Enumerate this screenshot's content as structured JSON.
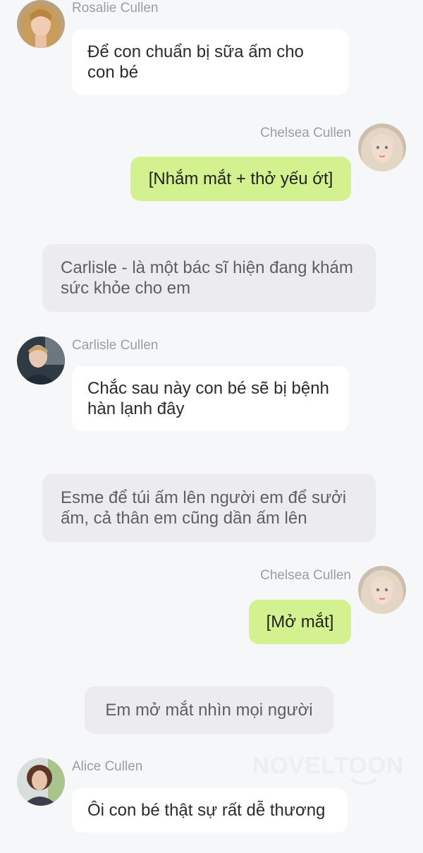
{
  "messages": [
    {
      "speaker": "Rosalie Cullen",
      "text": "Để con chuẩn bị sữa ấm cho con bé"
    },
    {
      "speaker": "Chelsea Cullen",
      "text": "[Nhắm mắt + thở yếu ớt]"
    },
    {
      "narration": "Carlisle - là một bác sĩ hiện đang khám sức khỏe cho em"
    },
    {
      "speaker": "Carlisle Cullen",
      "text": "Chắc sau này con bé sẽ bị bệnh hàn lạnh đây"
    },
    {
      "narration": "Esme để túi ấm lên người em để sưởi ấm, cả thân em cũng dần ấm lên"
    },
    {
      "speaker": "Chelsea Cullen",
      "text": "[Mở mắt]"
    },
    {
      "narration": "Em mở mắt nhìn mọi người"
    },
    {
      "speaker": "Alice Cullen",
      "text": "Ôi con bé thật sự rất dễ thương"
    }
  ],
  "watermark": "NOVELTOON",
  "colors": {
    "background": "#f6f7f9",
    "self_bubble": "#d3f28f",
    "other_bubble": "#ffffff",
    "narration_bubble": "#ececee"
  },
  "icons": {
    "avatar_rosalie": "avatar-rosalie-icon",
    "avatar_chelsea": "avatar-chelsea-icon",
    "avatar_carlisle": "avatar-carlisle-icon",
    "avatar_alice": "avatar-alice-icon"
  }
}
